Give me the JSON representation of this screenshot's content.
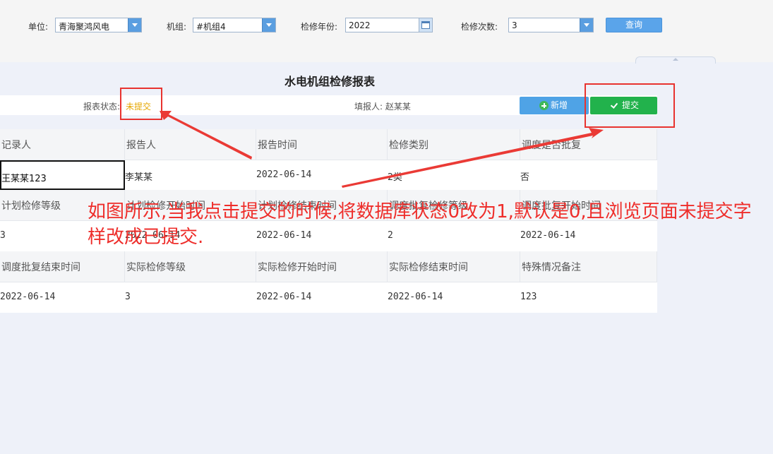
{
  "filters": {
    "unit_label": "单位:",
    "unit_value": "青海聚鸿风电",
    "machine_label": "机组:",
    "machine_value": "#机组4",
    "year_label": "检修年份:",
    "year_value": "2022",
    "count_label": "检修次数:",
    "count_value": "3",
    "query_label": "查询"
  },
  "report": {
    "title": "水电机组检修报表",
    "status_label": "报表状态:",
    "status_value": "未提交",
    "filler_label": "填报人: 赵某某",
    "add_label": "新增",
    "submit_label": "提交",
    "status_color": "#e6a700"
  },
  "grid": {
    "rows": [
      {
        "type": "head",
        "cells": [
          "记录人",
          "报告人",
          "报告时间",
          "检修类别",
          "调度是否批复"
        ]
      },
      {
        "type": "val",
        "cells": [
          "王某某123",
          "李某某",
          "2022-06-14",
          "2类",
          "否"
        ]
      },
      {
        "type": "head",
        "cells": [
          "计划检修等级",
          "计划检修开始时间",
          "计划检修结束时间",
          "调度批复检修等级",
          "调度批复开始时间"
        ]
      },
      {
        "type": "val",
        "cells": [
          "3",
          "2022-06-14",
          "2022-06-14",
          "2",
          "2022-06-14"
        ]
      },
      {
        "type": "head",
        "cells": [
          "调度批复结束时间",
          "实际检修等级",
          "实际检修开始时间",
          "实际检修结束时间",
          "特殊情况备注"
        ]
      },
      {
        "type": "val",
        "cells": [
          "2022-06-14",
          "3",
          "2022-06-14",
          "2022-06-14",
          "123"
        ]
      }
    ]
  },
  "annotation": {
    "text": "如图所示,当我点击提交的时候,将数据库状态0改为1,默认是0,且浏览页面未提交字样改成已提交.",
    "color": "#ee2d2a"
  },
  "colors": {
    "query_button": "#5aa4ea",
    "add_button": "#4fa3e6",
    "submit_button": "#22b24c"
  }
}
